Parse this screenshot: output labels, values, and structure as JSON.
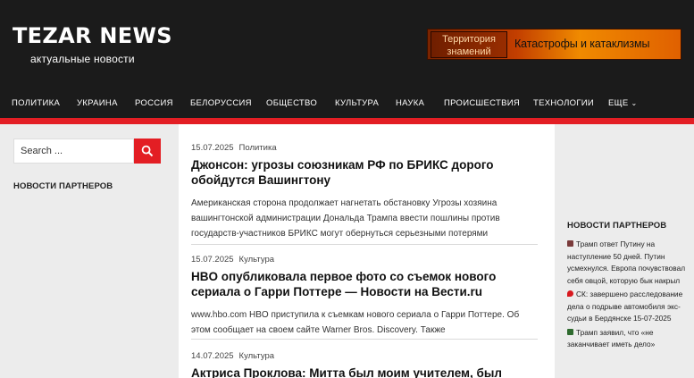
{
  "header": {
    "site_title": "TEZAR NEWS",
    "tagline": "актуальные новости",
    "banner": {
      "left_text": "Территория знамений",
      "right_text": "Катастрофы и катаклизмы"
    }
  },
  "nav": {
    "items": [
      "ПОЛИТИКА",
      "УКРАИНА",
      "РОССИЯ",
      "БЕЛОРУССИЯ",
      "ОБЩЕСТВО",
      "КУЛЬТУРА",
      "НАУКА",
      "ПРОИСШЕСТВИЯ",
      "ТЕХНОЛОГИИ",
      "ЕЩЕ"
    ]
  },
  "accent_color": "#e31e24",
  "left_sidebar": {
    "search_placeholder": "Search ...",
    "partners_title": "НОВОСТИ ПАРТНЕРОВ"
  },
  "posts": [
    {
      "date": "15.07.2025",
      "category": "Политика",
      "title": "Джонсон: угрозы союзникам РФ по БРИКС дорого обойдутся Вашингтону",
      "excerpt": "Американская сторона продолжает нагнетать обстановку Угрозы хозяина вашингтонской администрации Дональда Трампа ввести пошлины против государств-участников БРИКС могут обернуться серьезными потерями"
    },
    {
      "date": "15.07.2025",
      "category": "Культура",
      "title": "HBO опубликовала первое фото со съемок нового сериала о Гарри Поттере — Новости на Вести.ru",
      "excerpt": "www.hbo.com HBO приступила к съемкам нового сериала о Гарри Поттере. Об этом сообщает на своем сайте Warner Bros. Discovery. Также"
    },
    {
      "date": "14.07.2025",
      "category": "Культура",
      "title": "Актриса Проклова: Митта был моим учителем, был моим"
    }
  ],
  "right_sidebar": {
    "partners_title": "НОВОСТИ ПАРТНЕРОВ",
    "items": [
      {
        "icon": "news-source-icon",
        "icon_color": "#7a3b3b",
        "text": "Трамп ответ Путину на наступление 50 дней. Путин усмехнулся. Европа почувствовал себя овцой, которую бык накрыл"
      },
      {
        "icon": "pin-icon",
        "icon_color": "#d8191f",
        "text": "СК: завершено расследование дела о подрыве автомобиля экс-судьи в Бердянске 15-07-2025"
      },
      {
        "icon": "news-source-icon",
        "icon_color": "#2f6b2f",
        "text": "Трамп заявил, что «не заканчивает иметь дело»"
      }
    ]
  }
}
